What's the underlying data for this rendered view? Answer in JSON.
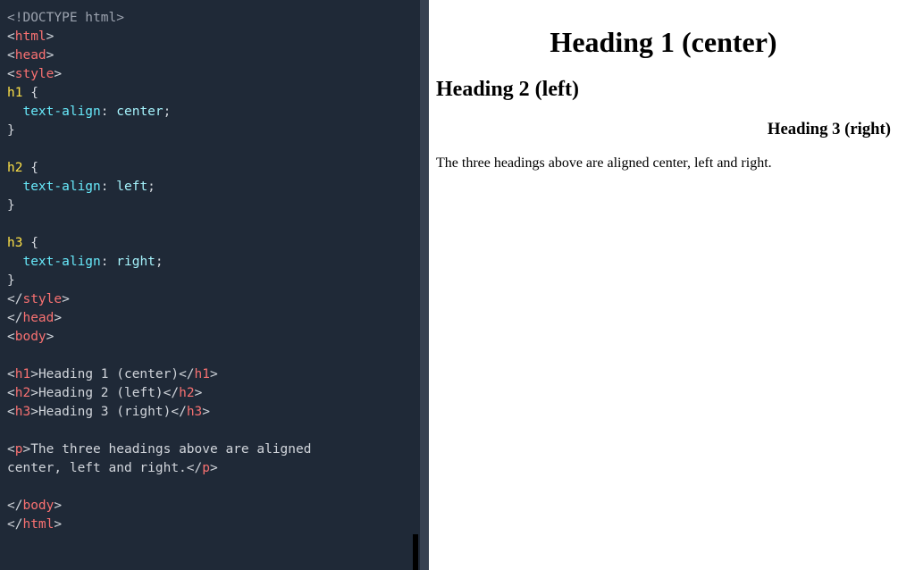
{
  "editor": {
    "lines": [
      [
        {
          "t": "<!DOCTYPE html>",
          "c": "c-doctype"
        }
      ],
      [
        {
          "t": "<",
          "c": "c-punct"
        },
        {
          "t": "html",
          "c": "c-tag"
        },
        {
          "t": ">",
          "c": "c-punct"
        }
      ],
      [
        {
          "t": "<",
          "c": "c-punct"
        },
        {
          "t": "head",
          "c": "c-tag"
        },
        {
          "t": ">",
          "c": "c-punct"
        }
      ],
      [
        {
          "t": "<",
          "c": "c-punct"
        },
        {
          "t": "style",
          "c": "c-tag"
        },
        {
          "t": ">",
          "c": "c-punct"
        }
      ],
      [
        {
          "t": "h1 ",
          "c": "c-sel"
        },
        {
          "t": "{",
          "c": "c-brace"
        }
      ],
      [
        {
          "t": "  ",
          "c": "c-text"
        },
        {
          "t": "text-align",
          "c": "c-prop"
        },
        {
          "t": ": ",
          "c": "c-punct"
        },
        {
          "t": "center",
          "c": "c-val"
        },
        {
          "t": ";",
          "c": "c-punct"
        }
      ],
      [
        {
          "t": "}",
          "c": "c-brace"
        }
      ],
      [
        {
          "t": "",
          "c": "c-text"
        }
      ],
      [
        {
          "t": "h2 ",
          "c": "c-sel"
        },
        {
          "t": "{",
          "c": "c-brace"
        }
      ],
      [
        {
          "t": "  ",
          "c": "c-text"
        },
        {
          "t": "text-align",
          "c": "c-prop"
        },
        {
          "t": ": ",
          "c": "c-punct"
        },
        {
          "t": "left",
          "c": "c-val"
        },
        {
          "t": ";",
          "c": "c-punct"
        }
      ],
      [
        {
          "t": "}",
          "c": "c-brace"
        }
      ],
      [
        {
          "t": "",
          "c": "c-text"
        }
      ],
      [
        {
          "t": "h3 ",
          "c": "c-sel"
        },
        {
          "t": "{",
          "c": "c-brace"
        }
      ],
      [
        {
          "t": "  ",
          "c": "c-text"
        },
        {
          "t": "text-align",
          "c": "c-prop"
        },
        {
          "t": ": ",
          "c": "c-punct"
        },
        {
          "t": "right",
          "c": "c-val"
        },
        {
          "t": ";",
          "c": "c-punct"
        }
      ],
      [
        {
          "t": "}",
          "c": "c-brace"
        }
      ],
      [
        {
          "t": "</",
          "c": "c-punct"
        },
        {
          "t": "style",
          "c": "c-tag"
        },
        {
          "t": ">",
          "c": "c-punct"
        }
      ],
      [
        {
          "t": "</",
          "c": "c-punct"
        },
        {
          "t": "head",
          "c": "c-tag"
        },
        {
          "t": ">",
          "c": "c-punct"
        }
      ],
      [
        {
          "t": "<",
          "c": "c-punct"
        },
        {
          "t": "body",
          "c": "c-tag"
        },
        {
          "t": ">",
          "c": "c-punct"
        }
      ],
      [
        {
          "t": "",
          "c": "c-text"
        }
      ],
      [
        {
          "t": "<",
          "c": "c-punct"
        },
        {
          "t": "h1",
          "c": "c-tag"
        },
        {
          "t": ">",
          "c": "c-punct"
        },
        {
          "t": "Heading 1 (center)",
          "c": "c-text"
        },
        {
          "t": "</",
          "c": "c-punct"
        },
        {
          "t": "h1",
          "c": "c-tag"
        },
        {
          "t": ">",
          "c": "c-punct"
        }
      ],
      [
        {
          "t": "<",
          "c": "c-punct"
        },
        {
          "t": "h2",
          "c": "c-tag"
        },
        {
          "t": ">",
          "c": "c-punct"
        },
        {
          "t": "Heading 2 (left)",
          "c": "c-text"
        },
        {
          "t": "</",
          "c": "c-punct"
        },
        {
          "t": "h2",
          "c": "c-tag"
        },
        {
          "t": ">",
          "c": "c-punct"
        }
      ],
      [
        {
          "t": "<",
          "c": "c-punct"
        },
        {
          "t": "h3",
          "c": "c-tag"
        },
        {
          "t": ">",
          "c": "c-punct"
        },
        {
          "t": "Heading 3 (right)",
          "c": "c-text"
        },
        {
          "t": "</",
          "c": "c-punct"
        },
        {
          "t": "h3",
          "c": "c-tag"
        },
        {
          "t": ">",
          "c": "c-punct"
        }
      ],
      [
        {
          "t": "",
          "c": "c-text"
        }
      ],
      [
        {
          "t": "<",
          "c": "c-punct"
        },
        {
          "t": "p",
          "c": "c-tag"
        },
        {
          "t": ">",
          "c": "c-punct"
        },
        {
          "t": "The three headings above are aligned ",
          "c": "c-text"
        }
      ],
      [
        {
          "t": "center, left and right.",
          "c": "c-text"
        },
        {
          "t": "</",
          "c": "c-punct"
        },
        {
          "t": "p",
          "c": "c-tag"
        },
        {
          "t": ">",
          "c": "c-punct"
        }
      ],
      [
        {
          "t": "",
          "c": "c-text"
        }
      ],
      [
        {
          "t": "</",
          "c": "c-punct"
        },
        {
          "t": "body",
          "c": "c-tag"
        },
        {
          "t": ">",
          "c": "c-punct"
        }
      ],
      [
        {
          "t": "</",
          "c": "c-punct"
        },
        {
          "t": "html",
          "c": "c-tag"
        },
        {
          "t": ">",
          "c": "c-punct"
        }
      ]
    ]
  },
  "preview": {
    "h1": "Heading 1 (center)",
    "h2": "Heading 2 (left)",
    "h3": "Heading 3 (right)",
    "p": "The three headings above are aligned center, left and right."
  }
}
